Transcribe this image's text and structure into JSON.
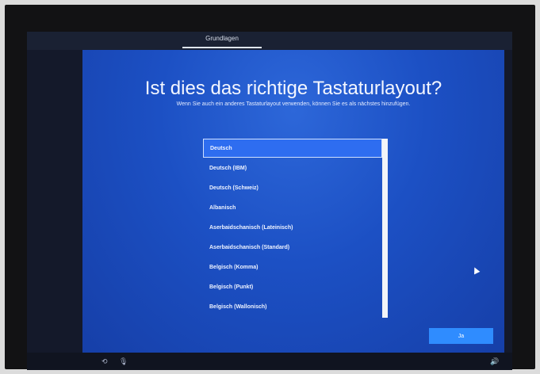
{
  "header": {
    "progress_tab": "Grundlagen"
  },
  "main": {
    "title": "Ist dies das richtige Tastaturlayout?",
    "subtitle": "Wenn Sie auch ein anderes Tastaturlayout verwenden, können Sie es als nächstes hinzufügen.",
    "keyboard_layouts": [
      {
        "label": "Deutsch",
        "selected": true
      },
      {
        "label": "Deutsch (IBM)"
      },
      {
        "label": "Deutsch (Schweiz)"
      },
      {
        "label": "Albanisch"
      },
      {
        "label": "Aserbaidschanisch (Lateinisch)"
      },
      {
        "label": "Aserbaidschanisch (Standard)"
      },
      {
        "label": "Belgisch (Komma)"
      },
      {
        "label": "Belgisch (Punkt)"
      },
      {
        "label": "Belgisch (Wallonisch)"
      }
    ]
  },
  "footer": {
    "primary_button": "Ja",
    "left_icons": [
      "accessibility-icon",
      "microphone-icon"
    ],
    "right_icon": "volume-icon"
  },
  "colors": {
    "background": "#1c50c4",
    "accent": "#2f8cff",
    "selection": "#2e6df0"
  }
}
